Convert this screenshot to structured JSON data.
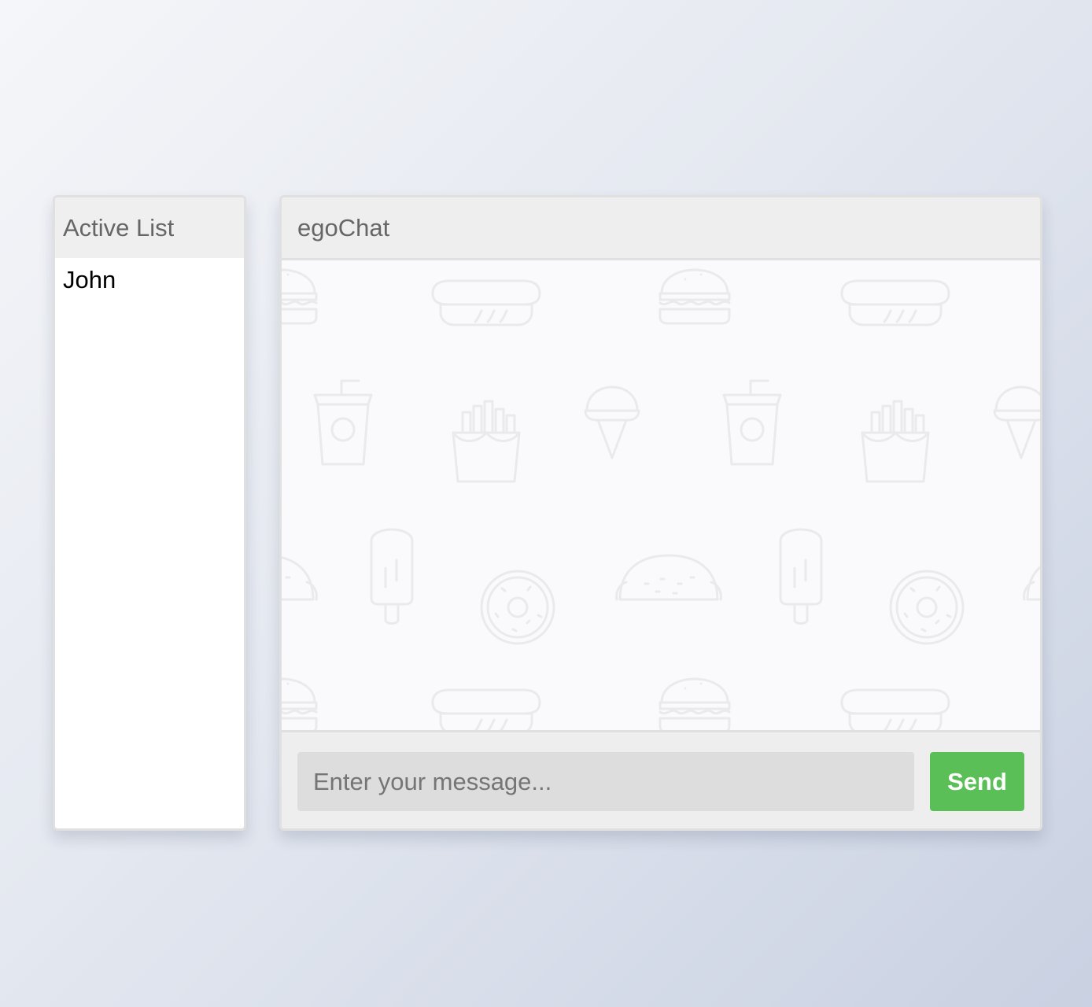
{
  "active_list": {
    "title": "Active List",
    "users": [
      "John"
    ]
  },
  "chat": {
    "title": "egoChat",
    "background_icons": [
      "burger-icon",
      "hotdog-icon",
      "soda-cup-icon",
      "fries-icon",
      "ice-cream-cone-icon",
      "taco-icon",
      "popsicle-icon",
      "donut-icon"
    ]
  },
  "composer": {
    "placeholder": "Enter your message...",
    "value": "",
    "send_label": "Send"
  },
  "colors": {
    "send_button": "#5bbf58",
    "header_bg": "#eeeeee",
    "input_bg": "#dddddd"
  }
}
